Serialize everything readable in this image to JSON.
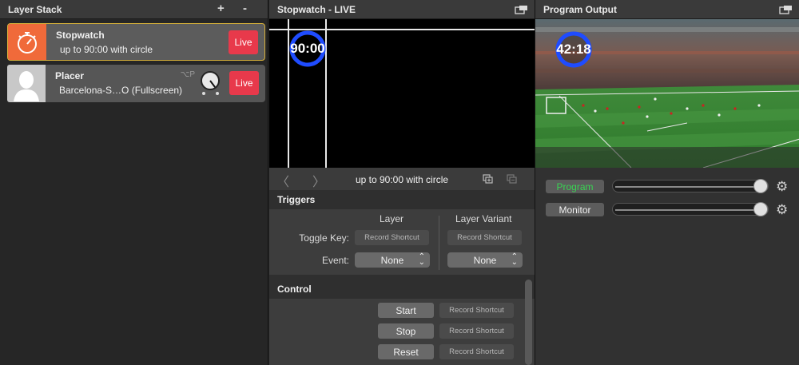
{
  "layer_stack": {
    "title": "Layer Stack",
    "add_label": "+",
    "remove_label": "-",
    "layers": [
      {
        "name": "Stopwatch",
        "variant": "up to 90:00 with circle",
        "live_label": "Live",
        "accent": "#f06a3a"
      },
      {
        "name": "Placer",
        "variant": "Barcelona-S…O (Fullscreen)",
        "live_label": "Live",
        "shortcut": "⌥P"
      }
    ]
  },
  "stopwatch": {
    "title": "Stopwatch - LIVE",
    "clock_value": "90:00",
    "nav_title": "up to 90:00 with circle",
    "triggers": {
      "title": "Triggers",
      "layer_col": "Layer",
      "variant_col": "Layer Variant",
      "toggle_key_label": "Toggle Key:",
      "event_label": "Event:",
      "record_shortcut": "Record Shortcut",
      "event_layer_value": "None",
      "event_variant_value": "None"
    },
    "control": {
      "title": "Control",
      "start_label": "Start",
      "stop_label": "Stop",
      "reset_label": "Reset",
      "record_shortcut": "Record Shortcut"
    }
  },
  "program_output": {
    "title": "Program Output",
    "clock_value": "42:18",
    "program_label": "Program",
    "monitor_label": "Monitor",
    "program_level": 1.0,
    "monitor_level": 1.0,
    "program_color": "#39d353"
  },
  "colors": {
    "live_red": "#e8394b",
    "active_border": "#d8b23a",
    "ring_blue": "#1f4cff"
  }
}
